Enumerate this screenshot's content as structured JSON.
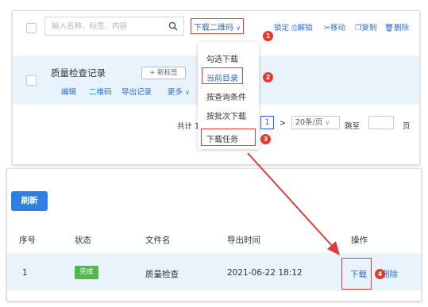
{
  "search": {
    "placeholder": "输入名称、标签、内容"
  },
  "toolbar": {
    "download_qr_label": "下载二维码",
    "lock_label": "锁定",
    "unlock_label": "解锁",
    "move_label": "移动",
    "copy_label": "复制",
    "delete_label": "删除"
  },
  "dropdown": {
    "items": [
      "勾选下载",
      "当前目录",
      "按查询条件",
      "按批次下载",
      "下载任务"
    ]
  },
  "record": {
    "title": "质量检查记录",
    "new_tag_label": "+ 新标签",
    "links": [
      "编辑",
      "二维码",
      "导出记录",
      "更多"
    ]
  },
  "pagination": {
    "total_label": "共计 1",
    "current_page": "1",
    "page_size": "20条/页",
    "jump_label": "跳至",
    "page_unit": "页"
  },
  "tasks": {
    "refresh_label": "刷新",
    "columns": [
      "序号",
      "状态",
      "文件名",
      "导出时间",
      "操作"
    ],
    "rows": [
      {
        "index": "1",
        "status": "完成",
        "file_name": "质量检查",
        "export_time": "2021-06-22 18:12",
        "download_label": "下载",
        "delete_label": "删除"
      }
    ]
  },
  "callouts": [
    "1",
    "2",
    "3",
    "4"
  ],
  "colors": {
    "accent": "#2a6ad8",
    "primary_button": "#2f7fe0",
    "highlight": "#e03a3a",
    "success": "#52b84a",
    "row_bg": "#e9f3fc"
  }
}
